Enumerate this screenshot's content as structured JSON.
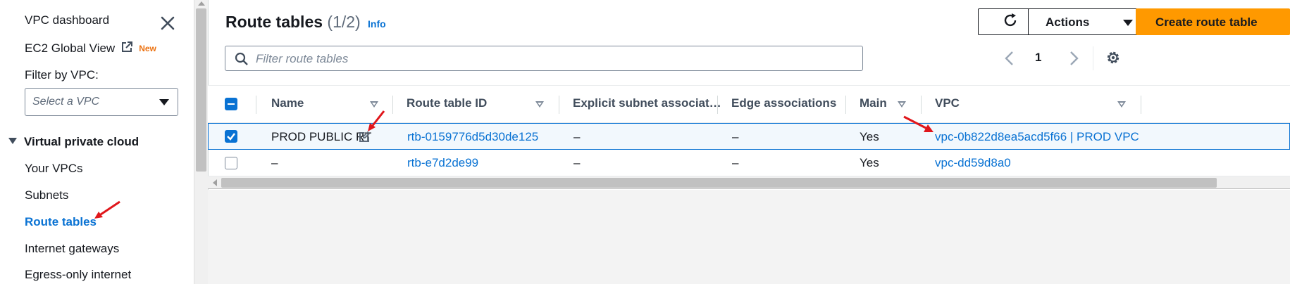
{
  "sidebar": {
    "dashboard": "VPC dashboard",
    "ec2_global_view": "EC2 Global View",
    "new_badge": "New",
    "filter_label": "Filter by VPC:",
    "vpc_select_placeholder": "Select a VPC",
    "section": "Virtual private cloud",
    "items": [
      {
        "label": "Your VPCs"
      },
      {
        "label": "Subnets"
      },
      {
        "label": "Route tables"
      },
      {
        "label": "Internet gateways"
      },
      {
        "label": "Egress-only internet"
      }
    ]
  },
  "main": {
    "title": "Route tables",
    "count": "(1/2)",
    "info": "Info",
    "actions_label": "Actions",
    "create_label": "Create route table",
    "filter_placeholder": "Filter route tables",
    "page_number": "1"
  },
  "table": {
    "columns": {
      "name": "Name",
      "route_table_id": "Route table ID",
      "explicit": "Explicit subnet associat…",
      "edge": "Edge associations",
      "main": "Main",
      "vpc": "VPC"
    },
    "rows": [
      {
        "name": "PROD PUBLIC RT",
        "id": "rtb-0159776d5d30de125",
        "explicit": "–",
        "edge": "–",
        "main": "Yes",
        "vpc": "vpc-0b822d8ea5acd5f66 | PROD VPC",
        "selected": true
      },
      {
        "name": "–",
        "id": "rtb-e7d2de99",
        "explicit": "–",
        "edge": "–",
        "main": "Yes",
        "vpc": "vpc-dd59d8a0",
        "selected": false
      }
    ]
  },
  "colors": {
    "link": "#0972d3",
    "primary_button": "#ff9900",
    "annotation_arrow": "#e0161b",
    "badge_new": "#ec7211"
  }
}
